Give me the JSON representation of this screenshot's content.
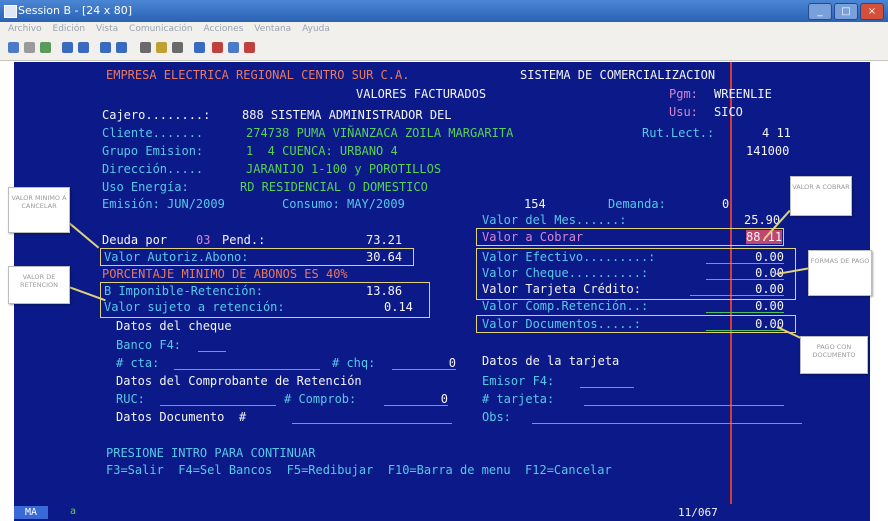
{
  "window": {
    "title": "Session B - [24 x 80]"
  },
  "menu": {
    "items": [
      "Archivo",
      "Edición",
      "Vista",
      "Comunicación",
      "Acciones",
      "Ventana",
      "Ayuda"
    ]
  },
  "header": {
    "company": "EMPRESA ELECTRICA REGIONAL CENTRO SUR C.A.",
    "system": "SISTEMA DE COMERCIALIZACION",
    "title": "VALORES FACTURADOS",
    "pgm_label": "Pgm:",
    "pgm_value": "WREENLIE",
    "usu_label": "Usu:",
    "usu_value": "SICO"
  },
  "fields": {
    "cajero_label": "Cajero........:",
    "cajero_value": "888 SISTEMA ADMINISTRADOR DEL",
    "cliente_label": "Cliente.......",
    "cliente_value": "274738 PUMA VIÑANZACA ZOILA MARGARITA",
    "rutlect_label": "Rut.Lect.:",
    "rutlect_value": "4 11",
    "rutlect_code": "141000",
    "grupo_label": "Grupo Emision:",
    "grupo_value": "1  4 CUENCA: URBANO 4",
    "direccion_label": "Dirección.....",
    "direccion_value": "JARANIJO 1-100 y POROTILLOS",
    "uso_label": "Uso Energía:",
    "uso_value": "RD RESIDENCIAL O DOMESTICO",
    "emision_label": "Emisión: JUN/2009",
    "consumo_label": "Consumo: MAY/2009",
    "consumo_value": "154",
    "demanda_label": "Demanda:",
    "demanda_value": "0"
  },
  "left": {
    "deuda_label": "Deuda por",
    "deuda_count": "03",
    "deuda_label2": "Pend.:",
    "deuda_value": "73.21",
    "autoriz_label": "Valor Autoriz.Abono:",
    "autoriz_value": "30.64",
    "porcentaje_label": "PORCENTAJE MINIMO DE ABONOS ES 40%",
    "imponible_label": "B Imponible-Retención:",
    "imponible_value": "13.86",
    "sujeto_label": "Valor sujeto a retención:",
    "sujeto_value": "0.14"
  },
  "right": {
    "valor_mes_label": "Valor del Mes......:",
    "valor_mes_value": "25.90",
    "cobrar_label": "Valor a Cobrar",
    "cobrar_value": "88.11",
    "efectivo_label": "Valor Efectivo.........:",
    "efectivo_value": "0.00",
    "cheque_label": "Valor Cheque..........:",
    "cheque_value": "0.00",
    "tarjeta_label": "Valor Tarjeta Crédito:",
    "tarjeta_value": "0.00",
    "comp_ret_label": "Valor Comp.Retención..:",
    "comp_ret_value": "0.00",
    "documentos_label": "Valor Documentos.....:",
    "documentos_value": "0.00"
  },
  "cheque": {
    "title": "Datos del cheque",
    "banco_label": "Banco F4:",
    "cta_label": "# cta:",
    "chq_label": "# chq:",
    "chq_value": "0"
  },
  "tarjeta": {
    "title": "Datos de la tarjeta",
    "emisor_label": "Emisor F4:",
    "num_label": "# tarjeta:",
    "obs_label": "Obs:"
  },
  "retencion": {
    "title": "Datos del Comprobante de Retención",
    "ruc_label": "RUC:",
    "comprob_label": "# Comprob:",
    "comprob_value": "0"
  },
  "documento": {
    "label": "Datos Documento  #"
  },
  "footer": {
    "prompt": "PRESIONE INTRO PARA CONTINUAR",
    "keys": "F3=Salir  F4=Sel Bancos  F5=Redibujar  F10=Barra de menu  F12=Cancelar"
  },
  "status": {
    "left": "MA",
    "a": "a",
    "position": "11/067"
  },
  "annotations": {
    "valor_minimo": "VALOR MINIMO A CANCELAR",
    "valor_retencion": "VALOR DE RETENCION",
    "valor_cobrar": "VALOR A COBRAR",
    "formas_detalle": "FORMAS DE PAGO",
    "pago_documento": "PAGO CON DOCUMENTO"
  },
  "colors": {
    "screen_bg": "#0b1a88",
    "highlight_box": "#e0d27a"
  }
}
